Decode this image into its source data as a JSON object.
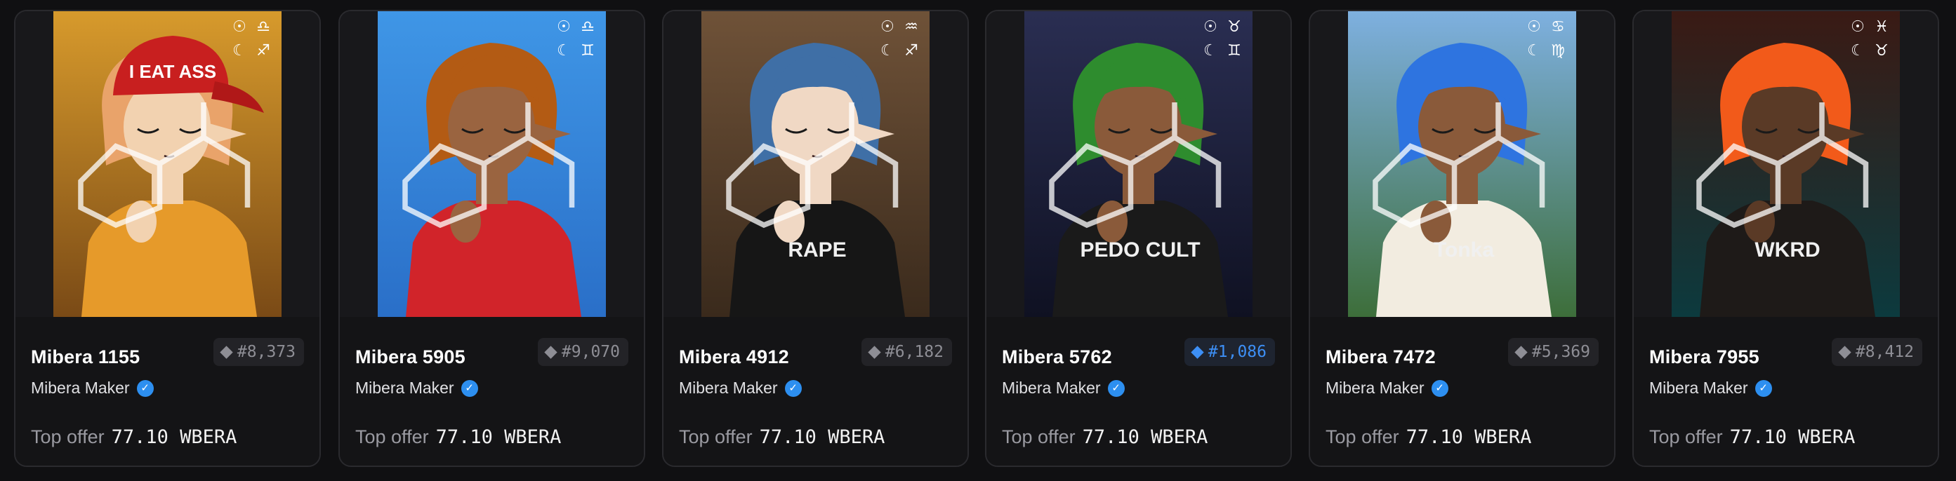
{
  "colors": {
    "page_bg": "#101012",
    "card_bg": "#1b1b1e",
    "accent_blue": "#3d8ff5",
    "rank_gray": "#8e8e95"
  },
  "offer_label": "Top offer",
  "cards": [
    {
      "name": "Mibera 1155",
      "rank": "#8,373",
      "rank_style": "gray",
      "creator": "Mibera Maker",
      "offer_value": "77.10 WBERA",
      "sun_sign": "☉",
      "sun_zodiac": "♎",
      "moon_sign": "☾",
      "moon_zodiac": "♐",
      "shirt_text": "",
      "hat_text": "I EAT ASS",
      "palette": {
        "bg_top": "#d79a2c",
        "bg_bottom": "#7a4a16",
        "hair": "#e9a36a",
        "shirt": "#e69a2a",
        "skin": "#f2d2b0"
      }
    },
    {
      "name": "Mibera 5905",
      "rank": "#9,070",
      "rank_style": "gray",
      "creator": "Mibera Maker",
      "offer_value": "77.10 WBERA",
      "sun_sign": "☉",
      "sun_zodiac": "♎",
      "moon_sign": "☾",
      "moon_zodiac": "♊",
      "shirt_text": "",
      "hat_text": "",
      "palette": {
        "bg_top": "#3f96e6",
        "bg_bottom": "#2a6fc8",
        "hair": "#b35b14",
        "shirt": "#d1242a",
        "skin": "#9a6440"
      }
    },
    {
      "name": "Mibera 4912",
      "rank": "#6,182",
      "rank_style": "gray",
      "creator": "Mibera Maker",
      "offer_value": "77.10 WBERA",
      "sun_sign": "☉",
      "sun_zodiac": "♒",
      "moon_sign": "☾",
      "moon_zodiac": "♐",
      "shirt_text": "RAPE",
      "hat_text": "",
      "palette": {
        "bg_top": "#6f5238",
        "bg_bottom": "#3a2a1c",
        "hair": "#3f6fa6",
        "shirt": "#161616",
        "skin": "#f0d8c4"
      }
    },
    {
      "name": "Mibera 5762",
      "rank": "#1,086",
      "rank_style": "blue",
      "creator": "Mibera Maker",
      "offer_value": "77.10 WBERA",
      "sun_sign": "☉",
      "sun_zodiac": "♉",
      "moon_sign": "☾",
      "moon_zodiac": "♊",
      "shirt_text": "PEDO CULT",
      "hat_text": "",
      "palette": {
        "bg_top": "#2a2e52",
        "bg_bottom": "#0f1122",
        "hair": "#2e8c2e",
        "shirt": "#1a1a1a",
        "skin": "#8a5a3a"
      }
    },
    {
      "name": "Mibera 7472",
      "rank": "#5,369",
      "rank_style": "gray",
      "creator": "Mibera Maker",
      "offer_value": "77.10 WBERA",
      "sun_sign": "☉",
      "sun_zodiac": "♋",
      "moon_sign": "☾",
      "moon_zodiac": "♍",
      "shirt_text": "Tonka",
      "hat_text": "",
      "palette": {
        "bg_top": "#7eb0e0",
        "bg_bottom": "#3d6e3a",
        "hair": "#2e74e0",
        "shirt": "#f2ece0",
        "skin": "#8a5a3a"
      }
    },
    {
      "name": "Mibera 7955",
      "rank": "#8,412",
      "rank_style": "gray",
      "creator": "Mibera Maker",
      "offer_value": "77.10 WBERA",
      "sun_sign": "☉",
      "sun_zodiac": "♓",
      "moon_sign": "☾",
      "moon_zodiac": "♉",
      "shirt_text": "WKRD",
      "hat_text": "",
      "palette": {
        "bg_top": "#3a1a14",
        "bg_bottom": "#0c3a3e",
        "hair": "#f25a1a",
        "shirt": "#1e1a18",
        "skin": "#5a3a26"
      }
    }
  ]
}
